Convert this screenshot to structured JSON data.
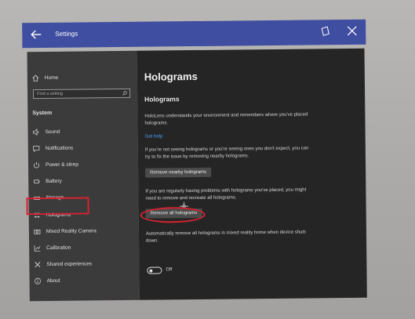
{
  "titlebar": {
    "title": "Settings"
  },
  "sidebar": {
    "home": "Home",
    "search_placeholder": "Find a setting",
    "section": "System",
    "items": [
      {
        "label": "Sound",
        "icon": "speaker-icon"
      },
      {
        "label": "Notifications",
        "icon": "notification-icon"
      },
      {
        "label": "Power & sleep",
        "icon": "power-icon"
      },
      {
        "label": "Battery",
        "icon": "battery-icon"
      },
      {
        "label": "Storage",
        "icon": "storage-icon"
      },
      {
        "label": "Holograms",
        "icon": "holograms-icon"
      },
      {
        "label": "Mixed Reality Camera",
        "icon": "camera-icon"
      },
      {
        "label": "Calibration",
        "icon": "calibration-icon"
      },
      {
        "label": "Shared experiences",
        "icon": "shared-icon"
      },
      {
        "label": "About",
        "icon": "info-icon"
      }
    ]
  },
  "main": {
    "title": "Holograms",
    "section_title": "Holograms",
    "intro": "HoloLens understands your environment and remembers where you've placed holograms.",
    "help_link": "Get help",
    "nearby_text": "If you're not seeing holograms or you're seeing ones you don't expect, you can try to fix the issue by removing nearby holograms.",
    "remove_nearby": "Remove nearby holograms",
    "all_text": "If you are regularly having problems with holograms you've placed, you might need to remove and recreate all holograms.",
    "remove_all": "Remove all holograms",
    "auto_text": "Automatically remove all holograms in mixed reality home when device shuts down.",
    "toggle_state": "Off"
  },
  "colors": {
    "titlebar": "#3f4ea0",
    "sidebar": "#3b3b3b",
    "content": "#252525",
    "link": "#4aa3ff",
    "highlight": "#d4232f"
  }
}
